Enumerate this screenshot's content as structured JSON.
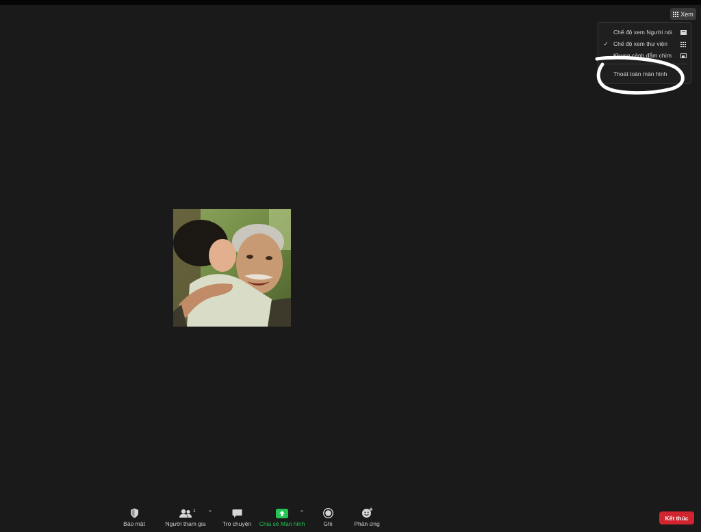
{
  "view_button": {
    "label": "Xem",
    "icon": "grid-icon"
  },
  "view_menu": {
    "items": [
      {
        "label": "Chế độ xem Người nói",
        "checked": false,
        "icon": "speaker-view-icon"
      },
      {
        "label": "Chế độ xem thư viện",
        "checked": true,
        "icon": "gallery-view-icon"
      },
      {
        "label": "Khung cảnh đắm chìm",
        "checked": false,
        "icon": "immersive-view-icon"
      }
    ],
    "exit_fullscreen": "Thoát toàn màn hình",
    "check_mark": "✓"
  },
  "toolbar": {
    "security": "Bảo mật",
    "participants": "Người tham gia",
    "participants_count": "1",
    "chat": "Trò chuyện",
    "share_screen": "Chia sẻ Màn hình",
    "record": "Ghi",
    "reactions": "Phản ứng",
    "caret": "^"
  },
  "end_button": {
    "label": "Kết thúc"
  },
  "colors": {
    "background": "#1a1a1a",
    "share_green": "#23c552",
    "end_red": "#d0242f"
  }
}
